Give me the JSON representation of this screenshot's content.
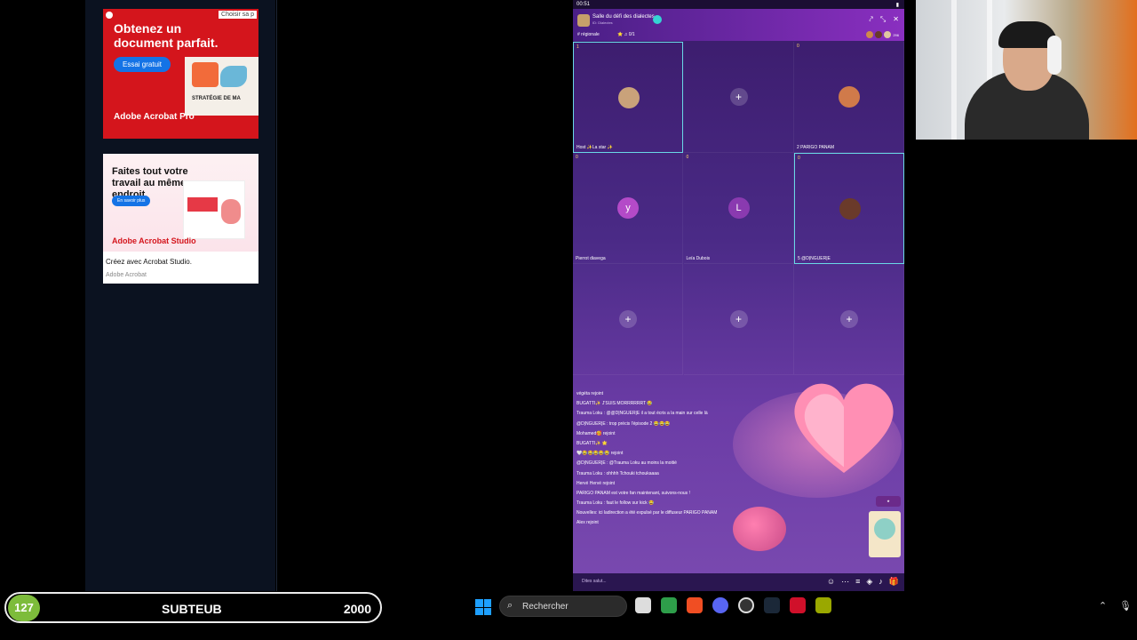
{
  "ads": {
    "ad1": {
      "adchoices": "Choisir sa p",
      "headline": "Obtenez un document parfait.",
      "cta": "Essai gratuit",
      "preview_text": "STRATÉGIE DE MA",
      "brand": "Adobe Acrobat Pro"
    },
    "ad2": {
      "headline": "Faites tout votre travail au même endroit.",
      "cta": "En savoir plus",
      "brand": "Adobe Acrobat Studio",
      "caption": "Créez avec Acrobat Studio.",
      "advertiser": "Adobe Acrobat"
    }
  },
  "phone": {
    "status_time": "00:51",
    "room_title": "Salle du défi des dialectes",
    "room_subtitle": "ID: Dialectes",
    "tag_region": "# régionale",
    "tag_count": "⭐ ♫ 0/1",
    "viewer_count": "296",
    "seats": [
      {
        "num": "1",
        "name": "Host ✨La star ✨",
        "type": "avatar",
        "color": "#c9a27a",
        "label": ""
      },
      {
        "num": "",
        "name": "",
        "type": "empty"
      },
      {
        "num": "0",
        "name": "2  PARIGO PANAM",
        "type": "avatar",
        "color": "#d07a4a",
        "label": ""
      },
      {
        "num": "0",
        "name": "Pierrot diavega",
        "type": "letter",
        "color": "#b44ac8",
        "label": "y"
      },
      {
        "num": "0",
        "name": "Leïa Dubois",
        "type": "letter",
        "color": "#8a3ab0",
        "label": "L"
      },
      {
        "num": "0",
        "name": "5 @D|NGUER|E",
        "type": "avatar",
        "color": "#6a3a2a",
        "label": ""
      },
      {
        "num": "",
        "name": "",
        "type": "empty"
      },
      {
        "num": "",
        "name": "",
        "type": "empty"
      },
      {
        "num": "",
        "name": "",
        "type": "empty"
      }
    ],
    "chat": [
      "végéta rejoint",
      "BUGATTI✨ J'SUIS MORRRRRRT 😂",
      "Trauma Loku : @@D|NGUER|E il a tout écris a la main sur celle là",
      "@D|NGUER|E : trop précis l'épisode 2 😂😂😂",
      "Mohamed🥰 rejoint",
      "BUGATTI✨ 🌟",
      "🤍😂😂😂😂😂 rejoint",
      "@D|NGUER|E : @Trauma Loku au moins la moitié",
      "Trauma Loku : ohhhh Tchouki tchoukaaaa",
      "Hervé Hervé rejoint",
      "PARIGO PANAM est votre fan maintenant, suivons-nous !",
      "Trauma Loku : faut le follow sur kick 😂",
      "Nouvelles: ici ladirection a été expulsé par le diffuseur PARIGO PANAM",
      "Alex rejoint"
    ],
    "input_placeholder": "Dites salut..."
  },
  "score": {
    "level": "127",
    "name": "SUBTEUB",
    "points": "2000"
  },
  "taskbar": {
    "search_label": "Rechercher"
  }
}
